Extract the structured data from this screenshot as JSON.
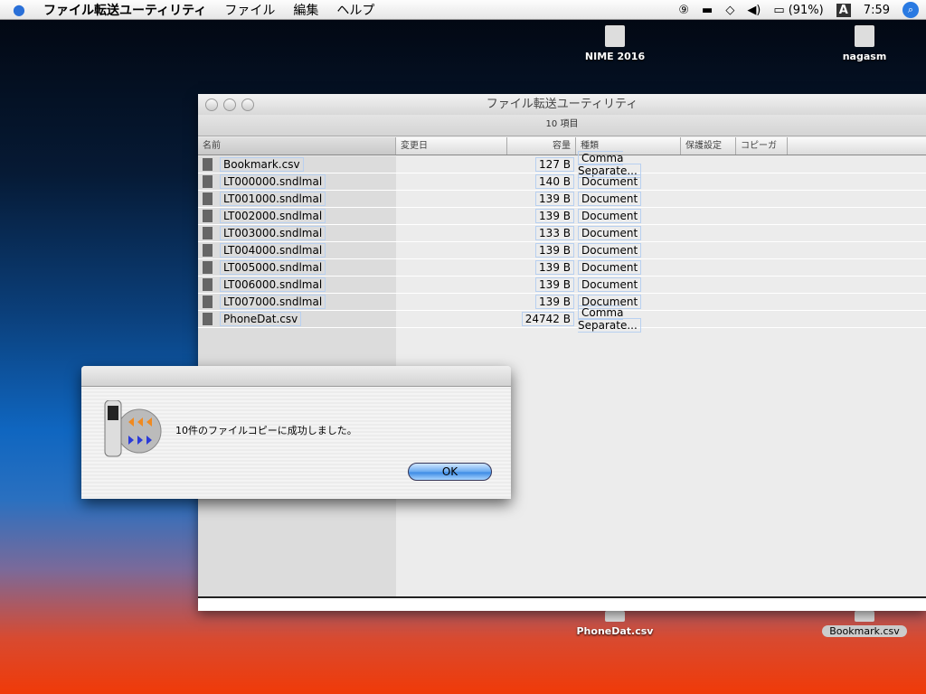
{
  "menubar": {
    "app": "ファイル転送ユーティリティ",
    "items": [
      "ファイル",
      "編集",
      "ヘルプ"
    ],
    "battery": "(91%)",
    "input": "A",
    "clock": "7:59"
  },
  "desktop": [
    {
      "label": "NIME 2016"
    },
    {
      "label": "nagasm"
    },
    {
      "label": "PhoneDat.csv"
    },
    {
      "label": "Bookmark.csv"
    }
  ],
  "window": {
    "title": "ファイル転送ユーティリティ",
    "status": "10 項目",
    "columns": [
      "名前",
      "変更日",
      "容量",
      "種類",
      "保護設定",
      "コピーガード"
    ],
    "rows": [
      {
        "name": "Bookmark.csv",
        "size": "127 B",
        "kind": "Comma Separate..."
      },
      {
        "name": "LT000000.sndlmal",
        "size": "140 B",
        "kind": "Document"
      },
      {
        "name": "LT001000.sndlmal",
        "size": "139 B",
        "kind": "Document"
      },
      {
        "name": "LT002000.sndlmal",
        "size": "139 B",
        "kind": "Document"
      },
      {
        "name": "LT003000.sndlmal",
        "size": "133 B",
        "kind": "Document"
      },
      {
        "name": "LT004000.sndlmal",
        "size": "139 B",
        "kind": "Document"
      },
      {
        "name": "LT005000.sndlmal",
        "size": "139 B",
        "kind": "Document"
      },
      {
        "name": "LT006000.sndlmal",
        "size": "139 B",
        "kind": "Document"
      },
      {
        "name": "LT007000.sndlmal",
        "size": "139 B",
        "kind": "Document"
      },
      {
        "name": "PhoneDat.csv",
        "size": "24742 B",
        "kind": "Comma Separate..."
      }
    ]
  },
  "dialog": {
    "message": "10件のファイルコピーに成功しました。",
    "ok": "OK"
  }
}
